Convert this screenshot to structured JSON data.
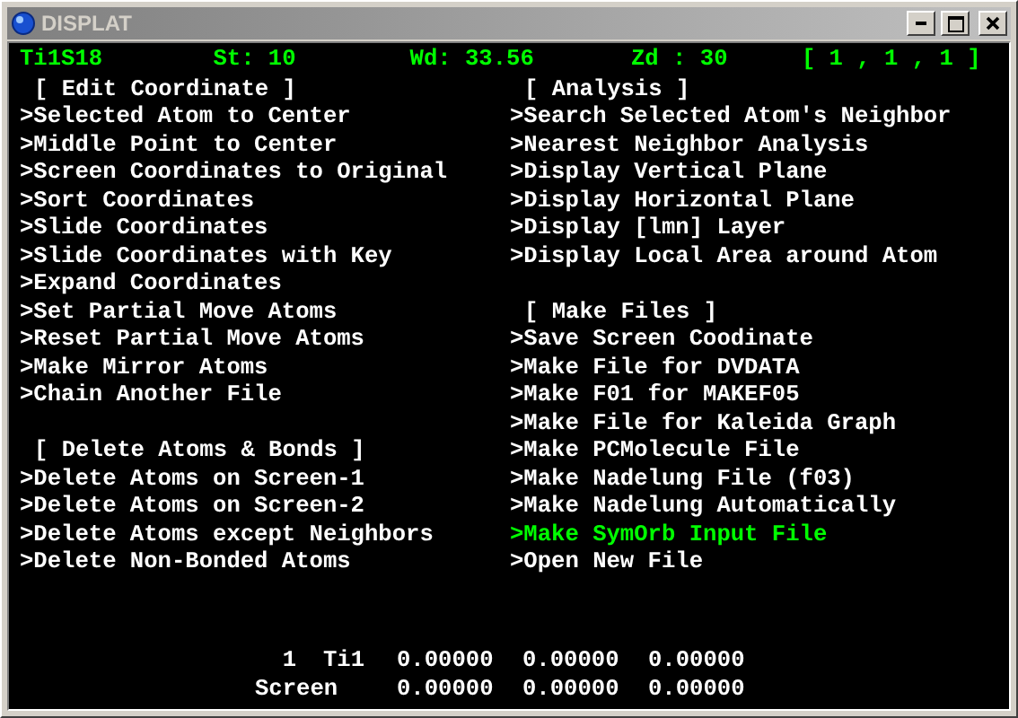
{
  "window": {
    "title": "DISPLAT"
  },
  "status": [
    "Ti1S18",
    "St: 10",
    "Wd: 33.56",
    "Zd : 30",
    "[ 1 , 1 , 1 ]"
  ],
  "columns": [
    {
      "sections": [
        {
          "heading": "[ Edit Coordinate ]",
          "items": [
            {
              "label": ">Selected Atom to Center",
              "selected": false
            },
            {
              "label": ">Middle Point to Center",
              "selected": false
            },
            {
              "label": ">Screen Coordinates to Original",
              "selected": false
            },
            {
              "label": ">Sort Coordinates",
              "selected": false
            },
            {
              "label": ">Slide Coordinates",
              "selected": false
            },
            {
              "label": ">Slide Coordinates with Key",
              "selected": false
            },
            {
              "label": ">Expand Coordinates",
              "selected": false
            },
            {
              "label": ">Set Partial Move Atoms",
              "selected": false
            },
            {
              "label": ">Reset Partial Move Atoms",
              "selected": false
            },
            {
              "label": ">Make Mirror Atoms",
              "selected": false
            },
            {
              "label": ">Chain Another File",
              "selected": false
            }
          ]
        },
        {
          "heading": "[ Delete Atoms & Bonds ]",
          "items": [
            {
              "label": ">Delete Atoms on Screen-1",
              "selected": false
            },
            {
              "label": ">Delete Atoms on Screen-2",
              "selected": false
            },
            {
              "label": ">Delete Atoms except Neighbors",
              "selected": false
            },
            {
              "label": ">Delete Non-Bonded Atoms",
              "selected": false
            }
          ]
        }
      ]
    },
    {
      "sections": [
        {
          "heading": "[ Analysis ]",
          "items": [
            {
              "label": ">Search Selected Atom's Neighbor",
              "selected": false
            },
            {
              "label": ">Nearest Neighbor Analysis",
              "selected": false
            },
            {
              "label": ">Display Vertical Plane",
              "selected": false
            },
            {
              "label": ">Display Horizontal Plane",
              "selected": false
            },
            {
              "label": ">Display [lmn] Layer",
              "selected": false
            },
            {
              "label": ">Display Local Area around Atom",
              "selected": false
            }
          ]
        },
        {
          "heading": "[ Make Files ]",
          "items": [
            {
              "label": ">Save Screen Coodinate",
              "selected": false
            },
            {
              "label": ">Make File for DVDATA",
              "selected": false
            },
            {
              "label": ">Make F01 for MAKEF05",
              "selected": false
            },
            {
              "label": ">Make File for Kaleida Graph",
              "selected": false
            },
            {
              "label": ">Make PCMolecule File",
              "selected": false
            },
            {
              "label": ">Make Nadelung File (f03)",
              "selected": false
            },
            {
              "label": ">Make Nadelung Automatically",
              "selected": false
            },
            {
              "label": ">Make SymOrb Input File",
              "selected": true
            },
            {
              "label": ">Open New File",
              "selected": false
            }
          ]
        }
      ]
    }
  ],
  "coordinates": [
    {
      "index": "1",
      "atom": "Ti1",
      "values": [
        "0.00000",
        "0.00000",
        "0.00000"
      ]
    },
    {
      "label": "Screen",
      "values": [
        "0.00000",
        "0.00000",
        "0.00000"
      ]
    }
  ]
}
